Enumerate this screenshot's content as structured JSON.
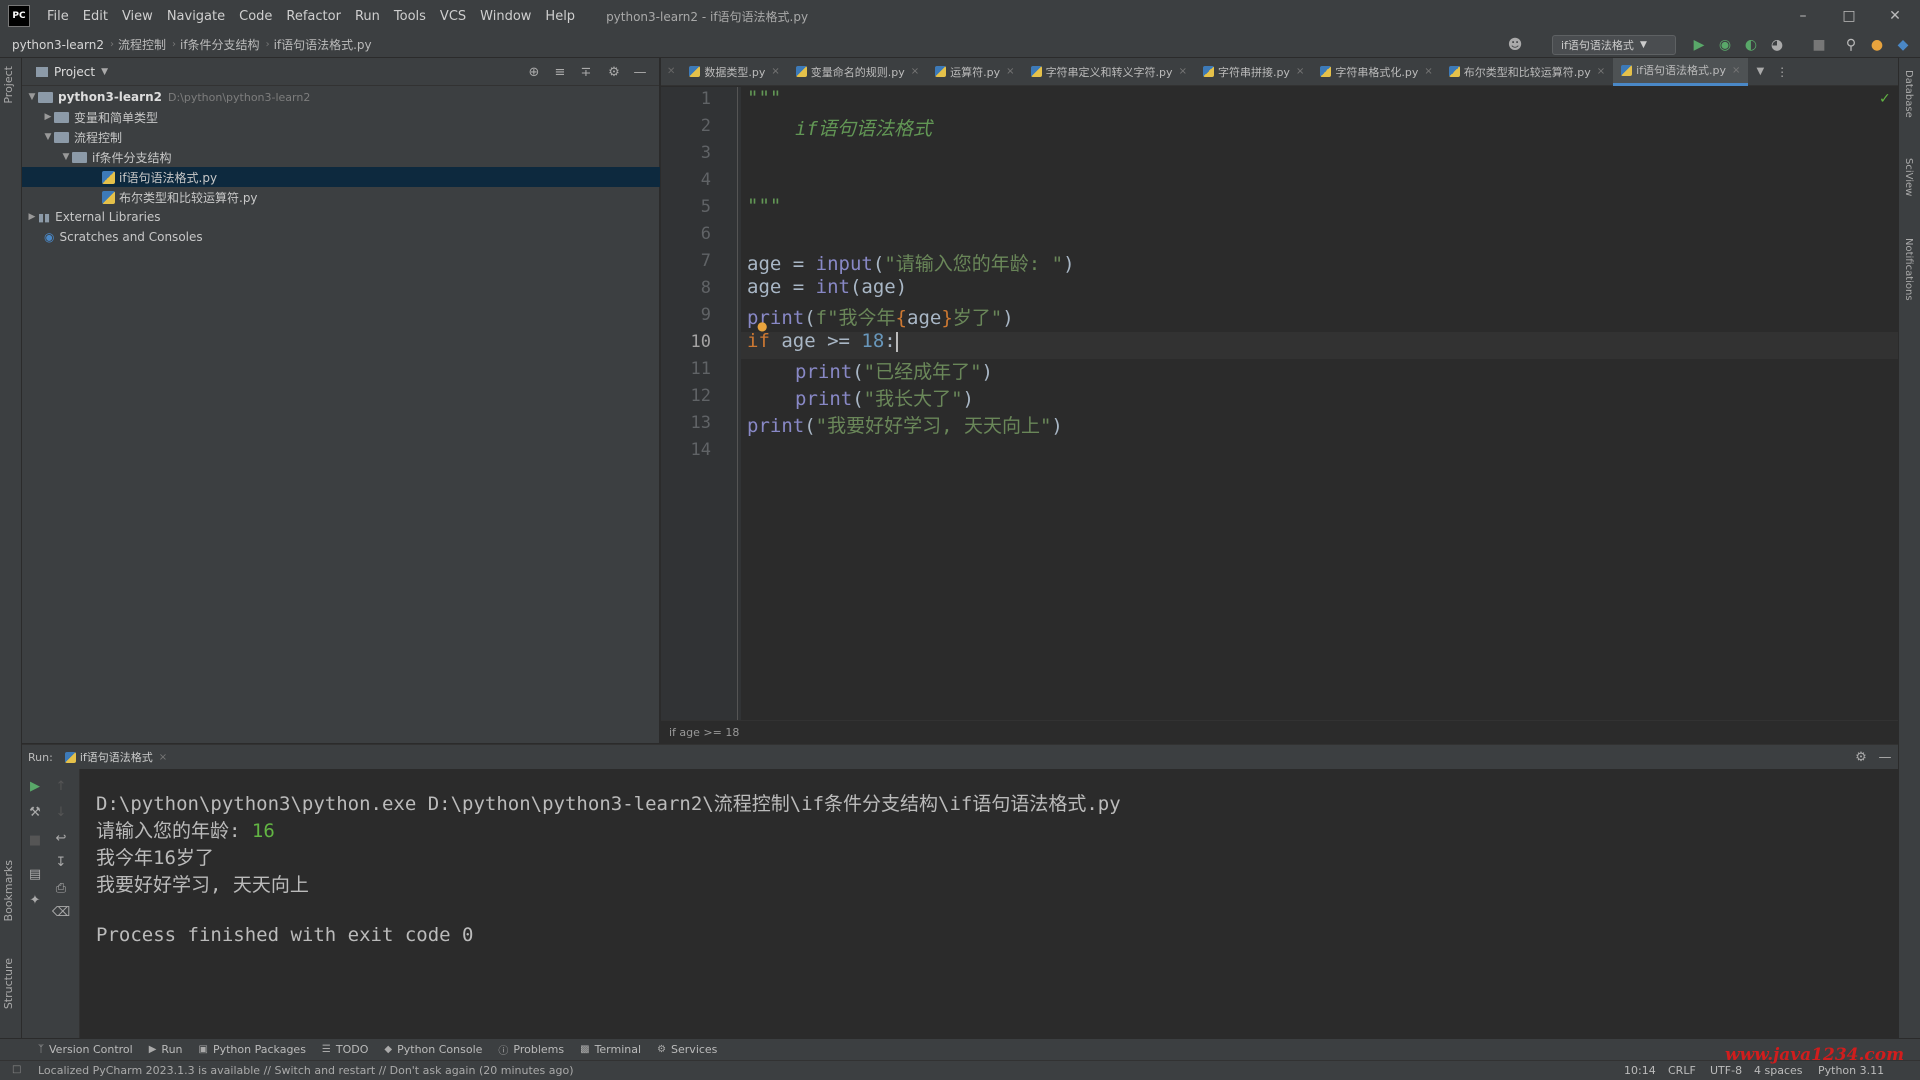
{
  "window": {
    "logo": "PC",
    "title": "python3-learn2 - if语句语法格式.py",
    "menu": [
      "File",
      "Edit",
      "View",
      "Navigate",
      "Code",
      "Refactor",
      "Run",
      "Tools",
      "VCS",
      "Window",
      "Help"
    ]
  },
  "breadcrumb": [
    "python3-learn2",
    "流程控制",
    "if条件分支结构",
    "if语句语法格式.py"
  ],
  "toolbar": {
    "run_config": "if语句语法格式"
  },
  "project": {
    "title": "Project",
    "tree": [
      {
        "label": "python3-learn2",
        "path": "D:\\python\\python3-learn2",
        "type": "folder",
        "open": true
      },
      {
        "label": "变量和简单类型",
        "type": "folder",
        "open": false
      },
      {
        "label": "流程控制",
        "type": "folder",
        "open": true
      },
      {
        "label": "if条件分支结构",
        "type": "folder",
        "open": true
      },
      {
        "label": "if语句语法格式.py",
        "type": "file"
      },
      {
        "label": "布尔类型和比较运算符.py",
        "type": "file"
      },
      {
        "label": "External Libraries",
        "type": "lib",
        "open": false
      },
      {
        "label": "Scratches and Consoles",
        "type": "scratch"
      }
    ]
  },
  "tabs": [
    "数据类型.py",
    "变量命名的规则.py",
    "运算符.py",
    "字符串定义和转义字符.py",
    "字符串拼接.py",
    "字符串格式化.py",
    "布尔类型和比较运算符.py",
    "if语句语法格式.py"
  ],
  "editor": {
    "line_numbers": [
      "1",
      "2",
      "3",
      "4",
      "5",
      "6",
      "7",
      "8",
      "9",
      "10",
      "11",
      "12",
      "13",
      "14"
    ],
    "current_line": "10",
    "code": {
      "l1": "\"\"\"",
      "l2": "if语句语法格式",
      "l5": "\"\"\"",
      "l7_var": "age",
      "l7_op": " = ",
      "l7_fn": "input",
      "l7_str": "\"请输入您的年龄: \"",
      "l8_var": "age",
      "l8_op": " = ",
      "l8_fn": "int",
      "l8_arg": "(age)",
      "l9_fn": "print",
      "l9_prefix": "f\"我今年",
      "l9_expr": "age",
      "l9_suffix": "岁了\"",
      "l10_kw": "if",
      "l10_cond": " age >= ",
      "l10_num": "18",
      "l10_colon": ":",
      "l11_fn": "print",
      "l11_str": "\"已经成年了\"",
      "l12_fn": "print",
      "l12_str": "\"我长大了\"",
      "l13_fn": "print",
      "l13_str": "\"我要好好学习, 天天向上\""
    },
    "breadcrumb": "if age >= 18"
  },
  "run": {
    "label": "Run:",
    "tab": "if语句语法格式",
    "output": {
      "cmd": "D:\\python\\python3\\python.exe D:\\python\\python3-learn2\\流程控制\\if条件分支结构\\if语句语法格式.py",
      "prompt": "请输入您的年龄: ",
      "input": "16",
      "line3": "我今年16岁了",
      "line4": "我要好好学习, 天天向上",
      "exit": "Process finished with exit code 0"
    }
  },
  "tool_windows": [
    "Version Control",
    "Run",
    "Python Packages",
    "TODO",
    "Python Console",
    "Problems",
    "Terminal",
    "Services"
  ],
  "side_tabs": {
    "left": [
      "Project",
      "Bookmarks",
      "Structure"
    ],
    "right": [
      "Database",
      "SciView",
      "Notifications"
    ]
  },
  "status": {
    "message": "Localized PyCharm 2023.1.3 is available // Switch and restart // Don't ask again (20 minutes ago)",
    "position": "10:14",
    "line_sep": "CRLF",
    "encoding": "UTF-8",
    "indent": "4 spaces",
    "interpreter": "Python 3.11"
  },
  "watermark": "www.java1234.com",
  "colors": {
    "accent": "#4a88c7",
    "keyword": "#cc7832",
    "string": "#6a8759",
    "number": "#6897bb"
  }
}
